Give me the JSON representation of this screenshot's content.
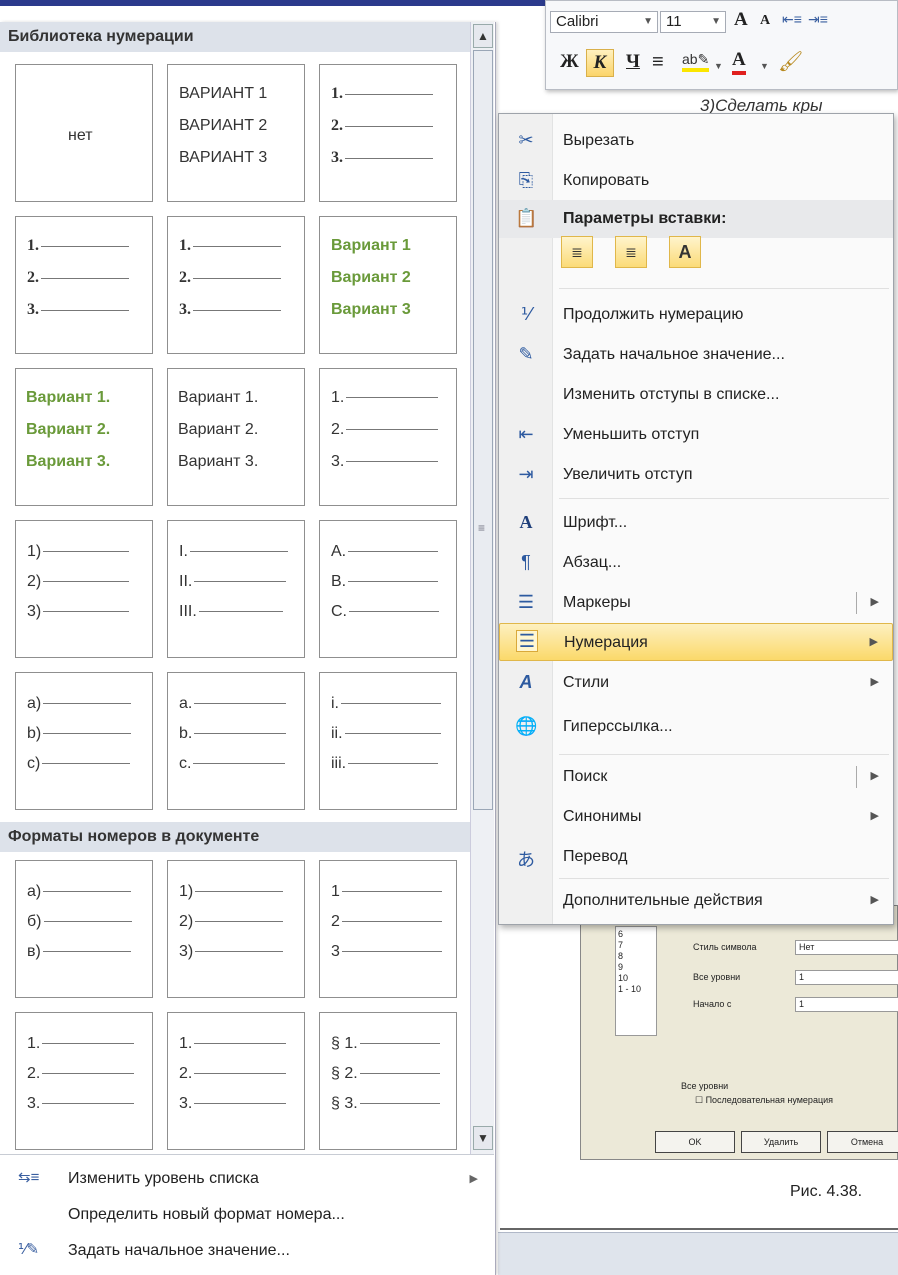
{
  "document": {
    "line_text": "3)Сделать кры",
    "caption": "Рис. 4.38.",
    "dialog": {
      "list": [
        "6",
        "7",
        "8",
        "9",
        "10",
        "1 - 10"
      ],
      "labels": {
        "char_style": "Стиль символа",
        "all_levels": "Все уровни",
        "start": "Начало с",
        "all_levels_group": "Все уровни",
        "consecutive": "Последовательная нумерация"
      },
      "values": {
        "char_style": "Нет",
        "all_levels": "1",
        "start": "1"
      },
      "buttons": {
        "ok": "OK",
        "delete": "Удалить",
        "cancel": "Отмена"
      }
    }
  },
  "mini_toolbar": {
    "font_name": "Calibri",
    "font_size": "11",
    "grow": "A",
    "shrink": "A",
    "bold": "Ж",
    "italic": "К",
    "underline": "Ч",
    "highlight_text": "ab",
    "font_color": "A"
  },
  "gallery": {
    "library_title": "Библиотека нумерации",
    "doc_formats_title": "Форматы номеров в документе",
    "cells": {
      "none": "нет",
      "variant_caps": [
        "ВАРИАНТ 1",
        "ВАРИАНТ 2",
        "ВАРИАНТ 3"
      ],
      "dec_bold": [
        "1.",
        "2.",
        "3."
      ],
      "green_bold": [
        "Вариант 1",
        "Вариант 2",
        "Вариант 3"
      ],
      "green_dot": [
        "Вариант 1.",
        "Вариант 2.",
        "Вариант 3."
      ],
      "plain_dot": [
        "Вариант 1.",
        "Вариант 2.",
        "Вариант 3."
      ],
      "dec_plain": [
        "1.",
        "2.",
        "3."
      ],
      "paren": [
        "1)",
        "2)",
        "3)"
      ],
      "roman_upper": [
        "I.",
        "II.",
        "III."
      ],
      "alpha_upper": [
        "A.",
        "B.",
        "C."
      ],
      "alpha_lower_paren": [
        "a)",
        "b)",
        "c)"
      ],
      "alpha_lower_dot": [
        "a.",
        "b.",
        "c."
      ],
      "roman_lower": [
        "i.",
        "ii.",
        "iii."
      ],
      "cyr_paren": [
        "а)",
        "б)",
        "в)"
      ],
      "num_paren": [
        "1)",
        "2)",
        "3)"
      ],
      "num_plain": [
        "1",
        "2",
        "3"
      ],
      "num_dot_a": [
        "1.",
        "2.",
        "3."
      ],
      "num_dot_b": [
        "1.",
        "2.",
        "3."
      ],
      "section": [
        "§ 1.",
        "§ 2.",
        "§ 3."
      ]
    },
    "bottom": {
      "change_level": "Изменить уровень списка",
      "define_format": "Определить новый формат номера...",
      "set_start": "Задать начальное значение..."
    }
  },
  "context_menu": {
    "cut": "Вырезать",
    "copy": "Копировать",
    "paste_options": "Параметры вставки:",
    "continue_numbering": "Продолжить нумерацию",
    "set_start_value": "Задать начальное значение...",
    "adjust_indents": "Изменить отступы в списке...",
    "decrease_indent": "Уменьшить отступ",
    "increase_indent": "Увеличить отступ",
    "font": "Шрифт...",
    "paragraph": "Абзац...",
    "bullets": "Маркеры",
    "numbering": "Нумерация",
    "styles": "Стили",
    "hyperlink": "Гиперссылка...",
    "search": "Поиск",
    "synonyms": "Синонимы",
    "translate": "Перевод",
    "more_actions": "Дополнительные действия"
  }
}
